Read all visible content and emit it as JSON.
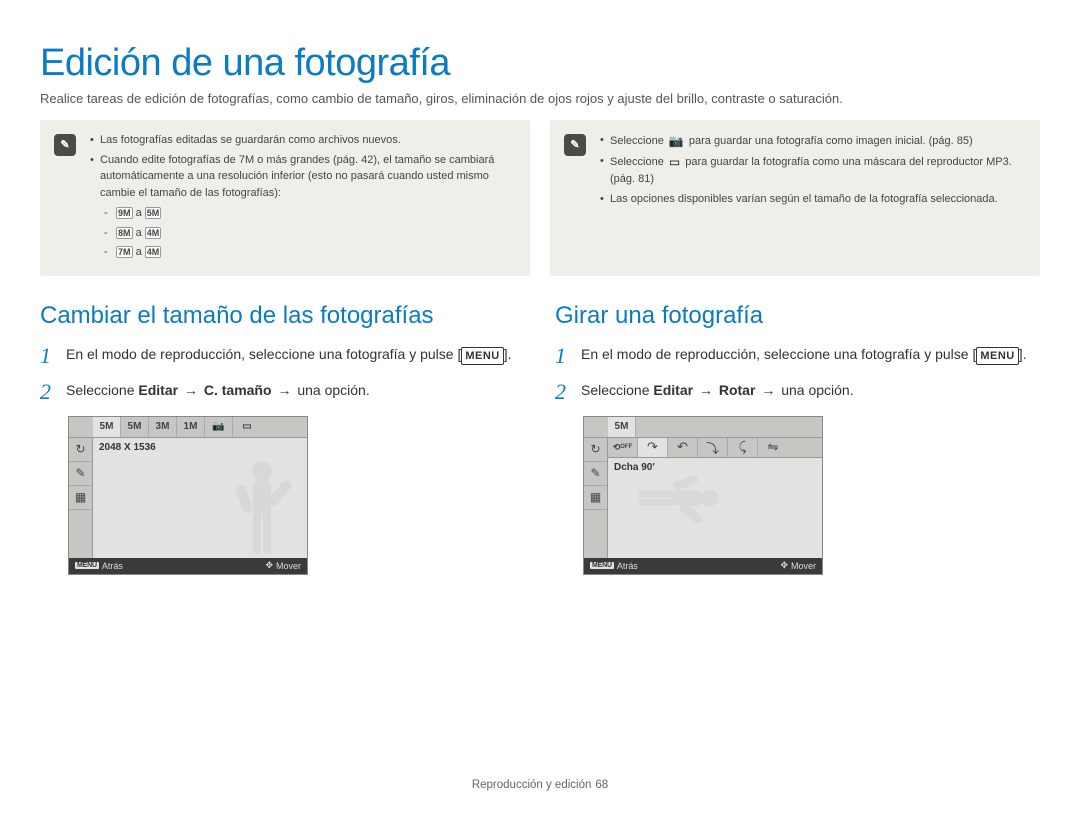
{
  "page": {
    "title": "Edición de una fotografía",
    "intro": "Realice tareas de edición de fotografías, como cambio de tamaño, giros, eliminación de ojos rojos y ajuste del brillo, contraste o saturación.",
    "footer_section": "Reproducción y edición",
    "footer_page": "68"
  },
  "notes_left": {
    "icon": "note-icon",
    "glyph": "✎",
    "items": [
      "Las fotografías editadas se guardarán como archivos nuevos.",
      "Cuando edite fotografías de 7M o más grandes (pág. 42), el tamaño se cambiará automáticamente a una resolución inferior (esto no pasará cuando usted mismo cambie el tamaño de las fotografías):"
    ],
    "sizes": [
      {
        "from": "9M",
        "to": "5M",
        "sep": "a"
      },
      {
        "from": "8M",
        "to": "4M",
        "sep": "a"
      },
      {
        "from": "7M",
        "to": "4M",
        "sep": "a"
      }
    ]
  },
  "notes_right": {
    "icon": "note-icon",
    "glyph": "✎",
    "items_parts": [
      {
        "pre": "Seleccione ",
        "icon": "camera-boot-icon",
        "post": " para guardar una fotografía como imagen inicial. (pág. 85)"
      },
      {
        "pre": "Seleccione ",
        "icon": "mp3-skin-icon",
        "post": " para guardar la fotografía como una máscara del reproductor MP3. (pág. 81)"
      }
    ],
    "last": "Las opciones disponibles varían según el tamaño de la fotografía seleccionada."
  },
  "left": {
    "heading": "Cambiar el tamaño de las fotografías",
    "step1_a": "En el modo de reproducción, seleccione una fotografía y pulse [",
    "step1_key": "MENU",
    "step1_b": "].",
    "step2_a": "Seleccione ",
    "step2_bold1": "Editar",
    "step2_arrow": "→",
    "step2_bold2": "C. tamaño",
    "step2_c": " una opción.",
    "screen": {
      "tabs": [
        "5M",
        "5M",
        "3M",
        "1M"
      ],
      "tabs_icons": [
        "camera-boot-icon",
        "mp3-skin-icon"
      ],
      "side_icons": [
        "↻",
        "✎",
        "▦"
      ],
      "label": "2048 X 1536",
      "footer_back": "Atrás",
      "footer_move": "Mover",
      "footer_menu": "MENU"
    }
  },
  "right": {
    "heading": "Girar una fotografía",
    "step1_a": "En el modo de reproducción, seleccione una fotografía y pulse [",
    "step1_key": "MENU",
    "step1_b": "].",
    "step2_a": "Seleccione ",
    "step2_bold1": "Editar",
    "step2_arrow": "→",
    "step2_bold2": "Rotar",
    "step2_c": " una opción.",
    "screen": {
      "topbar": [
        "5M"
      ],
      "side_icons": [
        "↻",
        "✎",
        "▦"
      ],
      "rot_icons": [
        "⟲off",
        "↷",
        "↶",
        "⤵",
        "⤹",
        "⇋"
      ],
      "rot_icons_semantics": [
        "off-icon",
        "right-90-icon",
        "left-90-icon",
        "right-180-icon",
        "horizontal-icon",
        "vertical-icon"
      ],
      "label": "Dcha 90'",
      "footer_back": "Atrás",
      "footer_move": "Mover",
      "footer_menu": "MENU"
    }
  }
}
